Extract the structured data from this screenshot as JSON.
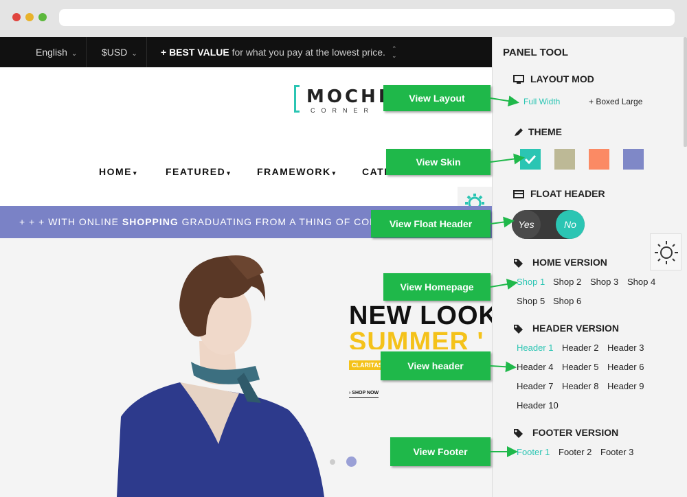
{
  "topbar": {
    "language": "English",
    "currency": "$USD",
    "promo_bold": "+ BEST VALUE",
    "promo_rest": "for what you pay at the lowest price."
  },
  "logo": {
    "word": "MOCHI",
    "sub": "CORNER"
  },
  "nav": [
    "HOME",
    "FEATURED",
    "FRAMEWORK",
    "CATEGORY"
  ],
  "stripe": {
    "pre": "+ + + WITH ONLINE",
    "bold": "SHOPPING",
    "post": "GRADUATING FROM A THING OF CONVE"
  },
  "hero": {
    "title": "NEW LOOK",
    "subtitle": "SUMMER '",
    "tag": "CLARITAS",
    "cta": "SHOP NOW"
  },
  "panel": {
    "title": "PANEL TOOL",
    "layout": {
      "title": "LAYOUT MOD",
      "options": [
        "Full Width",
        "+ Boxed Large"
      ]
    },
    "theme": {
      "title": "THEME",
      "swatches": [
        "#2bc5b3",
        "#bdb996",
        "#fb8a64",
        "#7f88c7"
      ]
    },
    "float_header": {
      "title": "FLOAT HEADER",
      "yes": "Yes",
      "no": "No"
    },
    "home_version": {
      "title": "HOME VERSION",
      "options": [
        "Shop 1",
        "Shop 2",
        "Shop 3",
        "Shop 4",
        "Shop 5",
        "Shop 6"
      ]
    },
    "header_version": {
      "title": "HEADER VERSION",
      "options": [
        "Header 1",
        "Header 2",
        "Header 3",
        "Header 4",
        "Header 5",
        "Header 6",
        "Header 7",
        "Header 8",
        "Header 9",
        "Header 10"
      ]
    },
    "footer_version": {
      "title": "FOOTER VERSION",
      "options": [
        "Footer 1",
        "Footer 2",
        "Footer 3"
      ]
    }
  },
  "callouts": [
    "View Layout",
    "View Skin",
    "View Float Header",
    "View Homepage",
    "View header",
    "View Footer"
  ],
  "colors": {
    "accent": "#2bc5b3",
    "callout": "#1fb84a",
    "stripe": "#7a82c6",
    "hero_yellow": "#f4c21a"
  }
}
